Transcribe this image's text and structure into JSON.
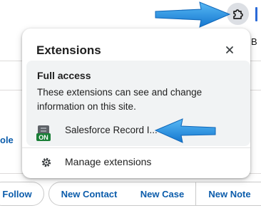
{
  "popup": {
    "title": "Extensions",
    "access_heading": "Full access",
    "access_description": "These extensions can see and change information on this site.",
    "extensions": [
      {
        "name": "Salesforce Record I...",
        "badge": "ON",
        "icon": "salesforce-inspector-icon"
      }
    ],
    "manage_label": "Manage extensions",
    "close_icon": "close-icon",
    "manage_icon": "gear-icon",
    "pin_icon": "pin-icon"
  },
  "toolbar": {
    "extensions_icon": "puzzle-piece-icon"
  },
  "background": {
    "partial_text_right": "B",
    "partial_text_left": "ole"
  },
  "actions": [
    {
      "label": "Follow"
    },
    {
      "label": "New Contact"
    },
    {
      "label": "New Case"
    },
    {
      "label": "New Note"
    }
  ],
  "colors": {
    "accent_blue": "#0b5cab",
    "annotation_arrow": "#1f8fe0",
    "badge_green": "#1a7f37"
  }
}
